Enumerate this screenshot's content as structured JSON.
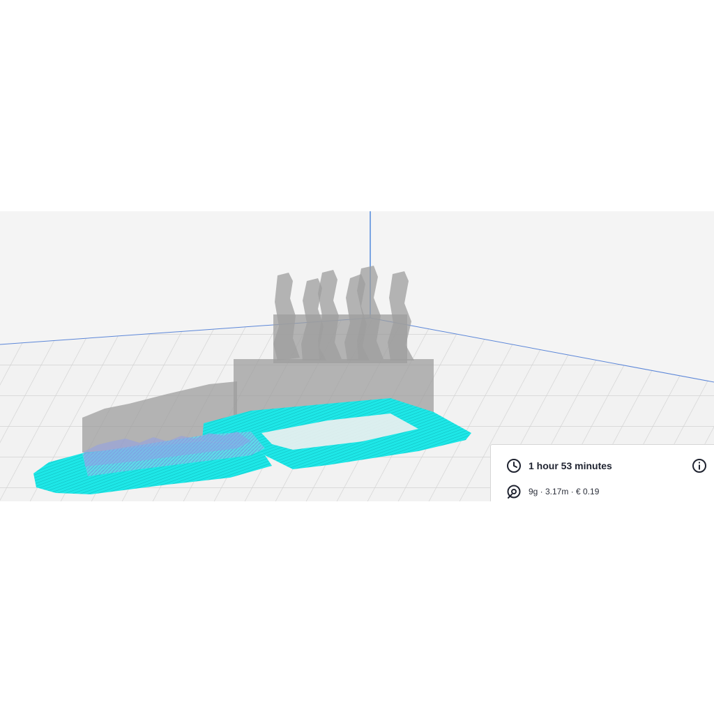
{
  "print_info": {
    "time_label": "1 hour 53 minutes",
    "material_label": "9g · 3.17m · € 0.19"
  },
  "icons": {
    "time": "clock-icon",
    "material": "spool-icon",
    "info": "info-icon"
  },
  "colors": {
    "toolpath": "#19e6e6",
    "model_ghost": "#a9a9a9",
    "build_plate": "#f4f4f4",
    "axis": "#2a6fd6"
  }
}
